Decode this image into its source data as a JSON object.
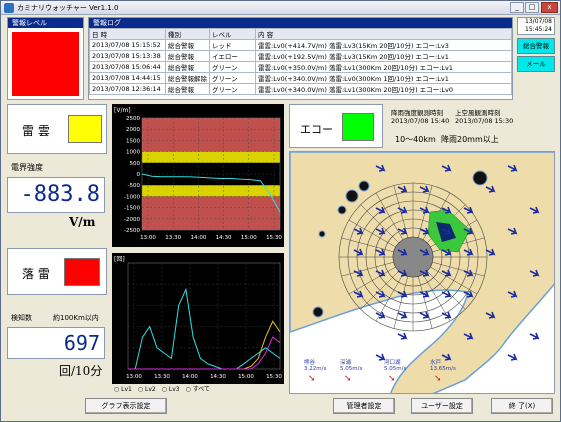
{
  "window": {
    "title": "カミナリウォッチャー Ver1.1.0",
    "min": "_",
    "max": "□",
    "close": "x"
  },
  "alarm_level": {
    "header": "警報レベル",
    "color": "#ff0000"
  },
  "alarm_log": {
    "header": "警報ログ",
    "columns": [
      "日 時",
      "種別",
      "レベル",
      "内 容"
    ],
    "rows": [
      [
        "2013/07/08 15:15:52",
        "総合警報",
        "レッド",
        "雷雲:Lv0(+414.7V/m) 落雷:Lv3(15Km 20回/10分) エコー:Lv3"
      ],
      [
        "2013/07/08 15:13:38",
        "総合警報",
        "イエロー",
        "雷雲:Lv0(+192.5V/m) 落雷:Lv3(15Km 20回/10分) エコー:Lv1"
      ],
      [
        "2013/07/08 15:06:44",
        "総合警報",
        "グリーン",
        "雷雲:Lv0(+350.0V/m) 落雷:Lv1(300Km 20回/10分) エコー:Lv1"
      ],
      [
        "2013/07/08 14:44:15",
        "総合警報解除",
        "グリーン",
        "雷雲:Lv0(+340.0V/m) 落雷:Lv0(300Km 1回/10分) エコー:Lv1"
      ],
      [
        "2013/07/08 12:36:14",
        "総合警報",
        "グリーン",
        "雷雲:Lv0(+340.0V/m) 落雷:Lv1(300Km 20回/10分) エコー:Lv0"
      ]
    ]
  },
  "clock": {
    "date": "13/07/08",
    "time": "15:45:24"
  },
  "side_buttons": {
    "overall": "総合警報",
    "mail": "メール"
  },
  "thundercloud": {
    "label": "雷 雲",
    "indicator_color": "#ffff00",
    "field_label": "電界強度",
    "value": "-883.8",
    "unit": "V/m"
  },
  "lightning": {
    "label": "落 雷",
    "indicator_color": "#ff0000",
    "count_label": "検知数",
    "range": "約100Km以内",
    "value": "697",
    "unit": "回/10分"
  },
  "echo": {
    "label": "エコー",
    "indicator_color": "#00ff00",
    "obs1_label": "降雨強度観測時刻",
    "obs1_time": "2013/07/08 15:40",
    "obs2_label": "上空風観測時刻",
    "obs2_time": "2013/07/08 15:30",
    "range": "10～40km",
    "rain": "降雨20mm以上"
  },
  "map_labels": [
    {
      "name": "熊谷",
      "speed": "3.22m/s"
    },
    {
      "name": "深浦",
      "speed": "5.05m/s"
    },
    {
      "name": "河口湖",
      "speed": "5.05m/s"
    },
    {
      "name": "水戸",
      "speed": "13.65m/s"
    }
  ],
  "chart_data": [
    {
      "type": "line",
      "title": "",
      "ylabel": "[V/m]",
      "ylim": [
        -2500,
        2500
      ],
      "yticks": [
        "2500",
        "2000",
        "1500",
        "1000",
        "500",
        "0",
        "-500",
        "-1000",
        "-1500",
        "-2000",
        "-2500"
      ],
      "categories": [
        "13:00",
        "13:30",
        "14:00",
        "14:30",
        "15:00",
        "15:30"
      ],
      "series": [
        {
          "values": [
            0,
            -100,
            -120,
            -120,
            -120,
            -130,
            -150,
            -180,
            -200,
            -200,
            -230,
            -250,
            -300,
            -900,
            -1700
          ]
        }
      ],
      "bands": [
        "#c0504d",
        "#d9d400"
      ]
    },
    {
      "type": "line",
      "title": "",
      "ylabel": "[回]",
      "ylim": [
        0,
        200
      ],
      "categories": [
        "13:00",
        "13:30",
        "14:00",
        "14:30",
        "15:00",
        "15:30"
      ],
      "series": [
        {
          "values": [
            0,
            0,
            60,
            80,
            40,
            30,
            20,
            120,
            150,
            60,
            20,
            10,
            5,
            0,
            0,
            0,
            10,
            20,
            30,
            40,
            30,
            20
          ]
        },
        {
          "values": [
            0,
            0,
            0,
            0,
            0,
            0,
            0,
            0,
            0,
            0,
            0,
            0,
            0,
            0,
            0,
            0,
            0,
            5,
            20,
            60,
            90,
            70
          ]
        },
        {
          "values": [
            0,
            0,
            0,
            0,
            0,
            0,
            0,
            0,
            0,
            0,
            0,
            0,
            0,
            0,
            0,
            0,
            0,
            0,
            10,
            30,
            60,
            50
          ]
        }
      ],
      "legend": [
        "Lv1",
        "Lv2",
        "Lv3",
        "すべて"
      ]
    }
  ],
  "buttons": {
    "graph_settings": "グラフ表示設定",
    "admin_settings": "管理者設定",
    "user_settings": "ユーザー設定",
    "exit": "終 了(X)"
  }
}
